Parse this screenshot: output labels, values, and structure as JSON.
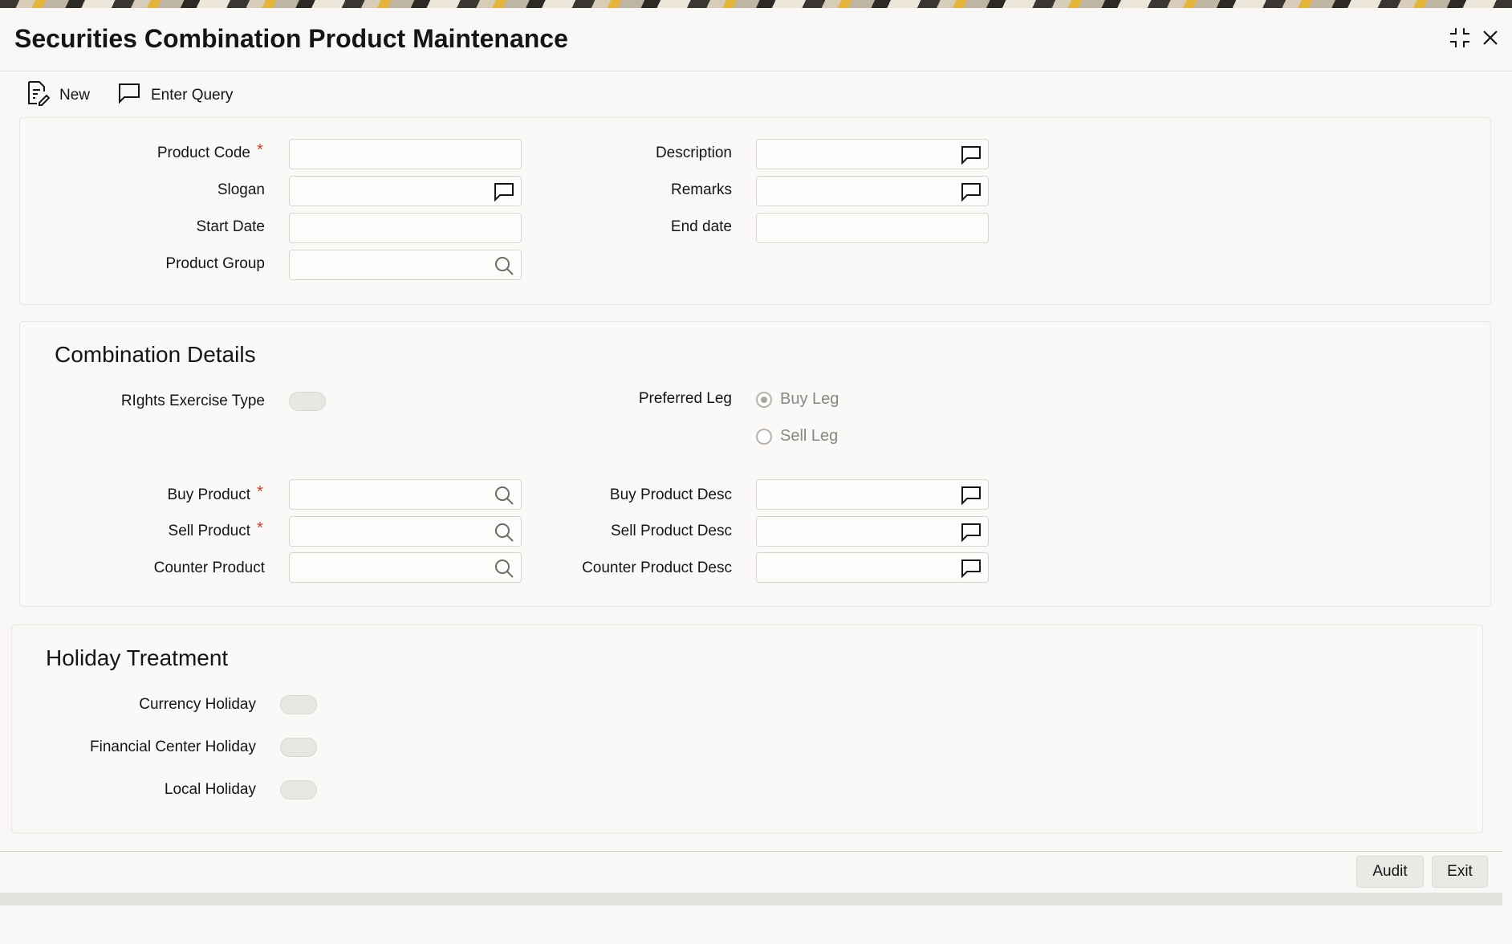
{
  "window": {
    "title": "Securities Combination Product Maintenance",
    "controls": [
      "minimize-icon",
      "close-icon"
    ]
  },
  "toolbar": {
    "new_label": "New",
    "enter_query_label": "Enter Query"
  },
  "product": {
    "product_code_label": "Product Code",
    "slogan_label": "Slogan",
    "start_date_label": "Start Date",
    "product_group_label": "Product Group",
    "description_label": "Description",
    "remarks_label": "Remarks",
    "end_date_label": "End date",
    "required_mark": "*"
  },
  "combination": {
    "title": "Combination Details",
    "rights_exercise_type_label": "RIghts Exercise Type",
    "rights_exercise_type_on": false,
    "preferred_leg_label": "Preferred Leg",
    "buy_leg_label": "Buy Leg",
    "sell_leg_label": "Sell Leg",
    "preferred_leg_selected": "Buy Leg",
    "buy_product_label": "Buy Product",
    "sell_product_label": "Sell Product",
    "counter_product_label": "Counter Product",
    "buy_product_desc_label": "Buy Product Desc",
    "sell_product_desc_label": "Sell Product Desc",
    "counter_product_desc_label": "Counter Product Desc"
  },
  "holiday": {
    "title": "Holiday Treatment",
    "currency_holiday_label": "Currency Holiday",
    "financial_center_holiday_label": "Financial Center Holiday",
    "local_holiday_label": "Local Holiday",
    "currency_holiday_on": false,
    "financial_center_holiday_on": false,
    "local_holiday_on": false
  },
  "footer": {
    "audit_label": "Audit",
    "exit_label": "Exit"
  }
}
